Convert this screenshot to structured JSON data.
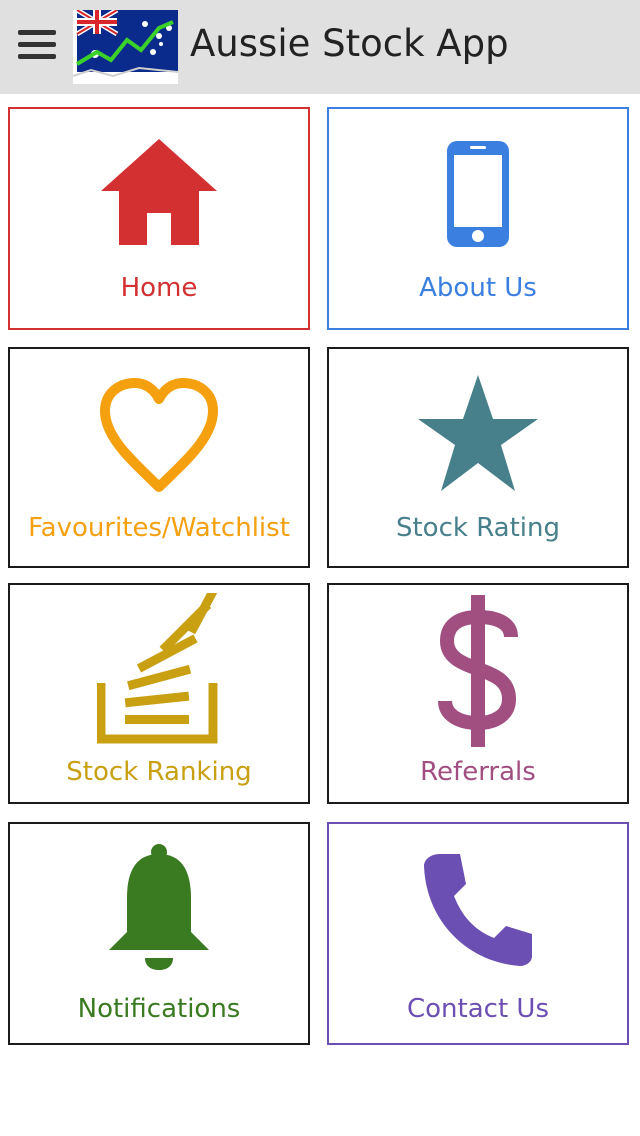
{
  "header": {
    "title": "Aussie Stock App",
    "menu_icon": "hamburger-menu-icon",
    "logo": "australian-flag-stock-chart-logo"
  },
  "tiles": [
    {
      "label": "Home",
      "icon": "home-icon",
      "color": "#d33131",
      "border": "#d33131"
    },
    {
      "label": "About Us",
      "icon": "smartphone-icon",
      "color": "#3b7fe0",
      "border": "#3b7fe0"
    },
    {
      "label": "Favourites/Watchlist",
      "icon": "heart-icon",
      "color": "#f5a00f",
      "border": "#1b1b1b"
    },
    {
      "label": "Stock Rating",
      "icon": "star-icon",
      "color": "#477f8a",
      "border": "#1b1b1b"
    },
    {
      "label": "Stock Ranking",
      "icon": "stack-overflow-icon",
      "color": "#c8a012",
      "border": "#1b1b1b"
    },
    {
      "label": "Referrals",
      "icon": "dollar-icon",
      "color": "#a04f80",
      "border": "#1b1b1b"
    },
    {
      "label": "Notifications",
      "icon": "bell-icon",
      "color": "#3a7a21",
      "border": "#1b1b1b"
    },
    {
      "label": "Contact Us",
      "icon": "phone-icon",
      "color": "#6c4fb3",
      "border": "#6c4fb3"
    }
  ]
}
